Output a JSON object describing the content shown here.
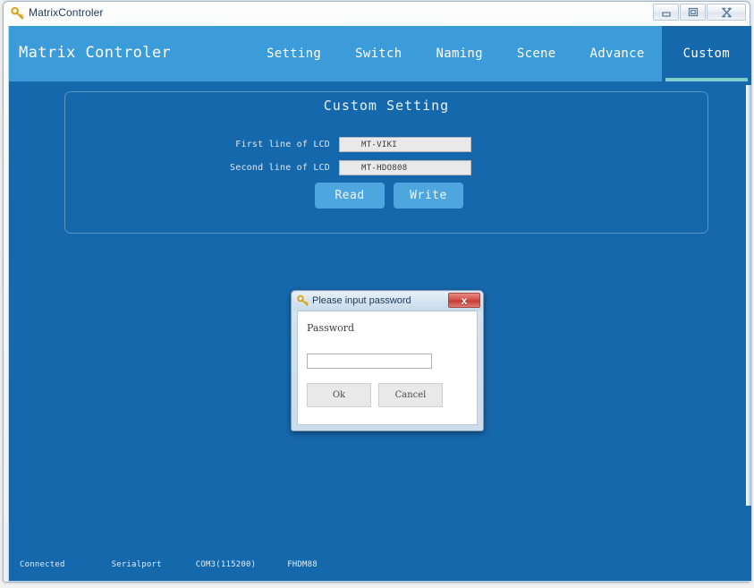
{
  "window": {
    "title": "MatrixControler",
    "icon": "key-icon",
    "controls": {
      "minimize": "minimize-icon",
      "maximize": "maximize-icon",
      "close": "close-icon"
    }
  },
  "nav": {
    "app_title": "Matrix Controler",
    "tabs": [
      {
        "label": "Setting",
        "active": false
      },
      {
        "label": "Switch",
        "active": false
      },
      {
        "label": "Naming",
        "active": false
      },
      {
        "label": "Scene",
        "active": false
      },
      {
        "label": "Advance",
        "active": false
      },
      {
        "label": "Custom",
        "active": true
      }
    ]
  },
  "panel": {
    "heading": "Custom Setting",
    "fields": [
      {
        "label": "First line of LCD",
        "value": "MT-VIKI",
        "placeholder": ""
      },
      {
        "label": "Second line of LCD",
        "value": "MT-HDO808",
        "placeholder": ""
      }
    ],
    "buttons": [
      {
        "label": "Read"
      },
      {
        "label": "Write"
      }
    ]
  },
  "dialog": {
    "title": "Please input password",
    "icon": "key-icon",
    "close_glyph": "x",
    "label": "Password",
    "input_value": "",
    "input_placeholder": "",
    "ok_label": "Ok",
    "cancel_label": "Cancel"
  },
  "statusbar": {
    "items": [
      "Connected",
      "Serialport",
      "COM3(115200)",
      "FHDM88"
    ]
  },
  "colors": {
    "nav_bar": "#3b9cd9",
    "body_blue": "#1668ad",
    "active_tab_underline": "#7fccc8",
    "button_blue": "#4da6dd",
    "close_red": "#d4524b"
  }
}
